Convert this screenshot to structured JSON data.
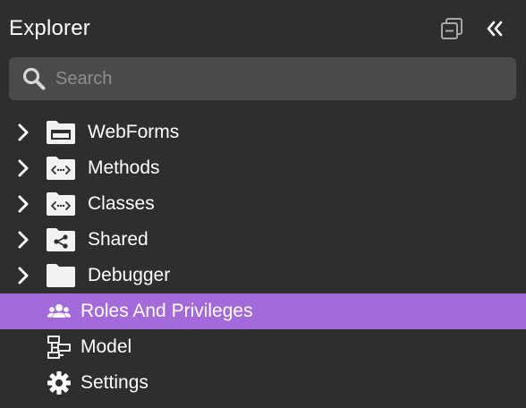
{
  "header": {
    "title": "Explorer",
    "collapse_all_icon": "collapse-all-icon",
    "hide_panel_icon": "double-chevron-left-icon"
  },
  "search": {
    "placeholder": "Search",
    "value": "",
    "icon": "search-icon"
  },
  "tree": {
    "items": [
      {
        "label": "WebForms",
        "icon": "webform-folder-icon",
        "expandable": true
      },
      {
        "label": "Methods",
        "icon": "code-folder-icon",
        "expandable": true
      },
      {
        "label": "Classes",
        "icon": "code-folder-icon",
        "expandable": true
      },
      {
        "label": "Shared",
        "icon": "share-folder-icon",
        "expandable": true
      },
      {
        "label": "Debugger",
        "icon": "folder-icon",
        "expandable": true
      },
      {
        "label": "Roles And Privileges",
        "icon": "users-icon",
        "expandable": false,
        "selected": true
      },
      {
        "label": "Model",
        "icon": "model-icon",
        "expandable": false
      },
      {
        "label": "Settings",
        "icon": "gear-icon",
        "expandable": false
      }
    ]
  },
  "colors": {
    "background": "#2e2e2e",
    "search_bg": "#4a4a4a",
    "selected_bg": "#a56ad9",
    "text": "#ffffff",
    "placeholder": "#8e8e8e"
  }
}
